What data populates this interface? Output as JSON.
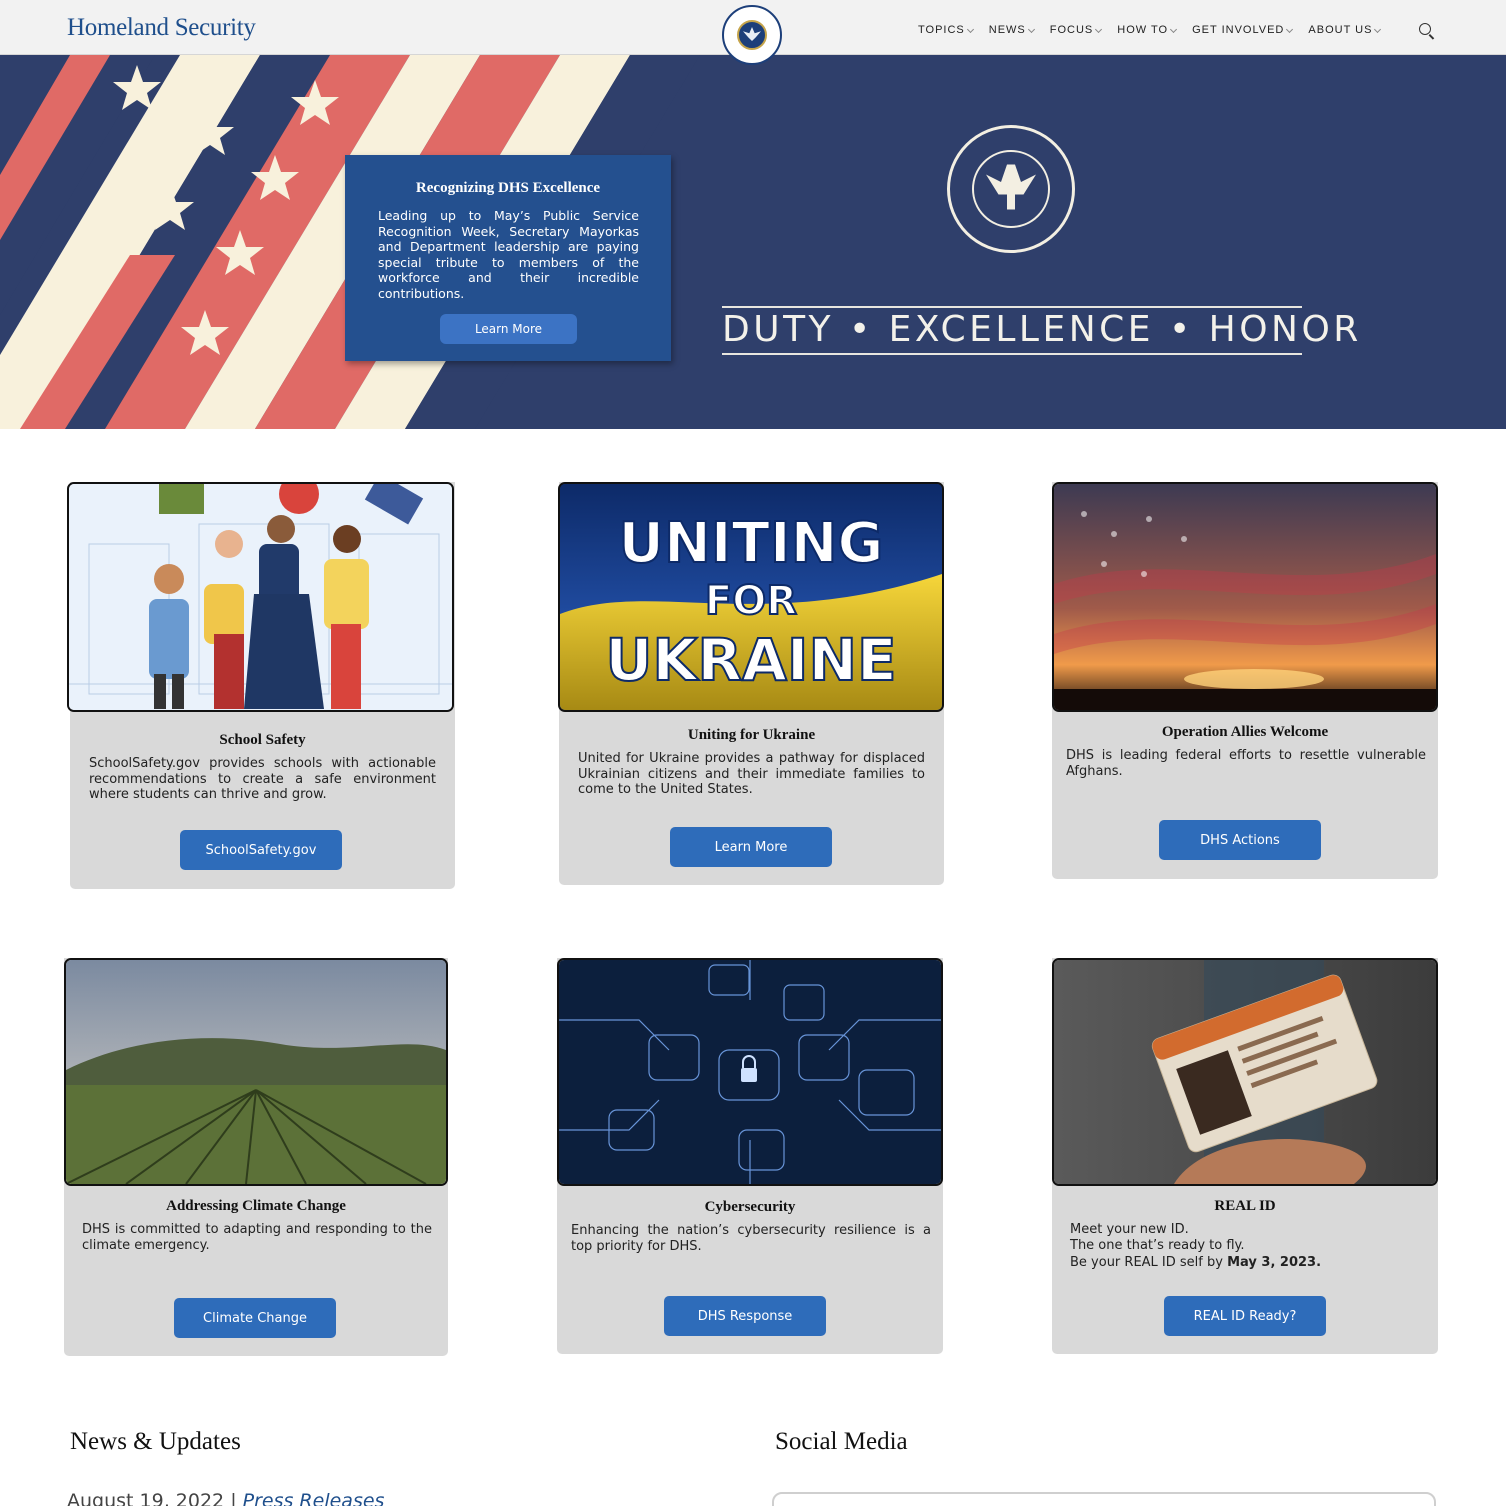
{
  "header": {
    "brand": "Homeland Security",
    "nav": [
      {
        "label": "TOPICS"
      },
      {
        "label": "NEWS"
      },
      {
        "label": "FOCUS"
      },
      {
        "label": "HOW TO"
      },
      {
        "label": "GET INVOLVED"
      },
      {
        "label": "ABOUT US"
      }
    ],
    "search_icon": "search-icon"
  },
  "hero": {
    "title": "Recognizing DHS Excellence",
    "body": "Leading up to May’s Public Service Recognition Week, Secretary Mayorkas and Department leadership are paying special tribute to members of the workforce and their incredible contributions.",
    "button": "Learn More",
    "motto": "DUTY • EXCELLENCE • HONOR",
    "colors": {
      "navy": "#2f3f6b",
      "box": "#24508f",
      "stripe_red": "#e06a66",
      "stripe_cream": "#f8f1dc"
    }
  },
  "cards": [
    {
      "title": "School Safety",
      "body": "SchoolSafety.gov provides schools with actionable recommendations to create a safe environment where students can thrive and grow.",
      "button": "SchoolSafety.gov"
    },
    {
      "title": "Uniting for Ukraine",
      "body": "United for Ukraine provides a pathway for displaced Ukrainian citizens and their immediate families to come to the United States.",
      "button": "Learn More",
      "image_text": [
        "UNITING",
        "FOR",
        "UKRAINE"
      ]
    },
    {
      "title": "Operation Allies Welcome",
      "body": "DHS is leading federal efforts to resettle vulnerable Afghans.",
      "button": "DHS Actions"
    },
    {
      "title": "Addressing Climate Change",
      "body": "DHS is committed to adapting and responding to the climate emergency.",
      "button": "Climate Change"
    },
    {
      "title": "Cybersecurity",
      "body": "Enhancing the nation’s cybersecurity resilience is a top priority for DHS.",
      "button": "DHS Response"
    },
    {
      "title": "REAL ID",
      "lines": [
        "Meet your new ID.",
        "The one that’s ready to fly.",
        "Be your REAL ID self by"
      ],
      "date": "May 3, 2023.",
      "button": "REAL ID Ready?"
    }
  ],
  "news": {
    "title": "News & Updates",
    "date": "August 19, 2022",
    "separator": "|",
    "category": "Press Releases"
  },
  "social": {
    "title": "Social Media"
  }
}
